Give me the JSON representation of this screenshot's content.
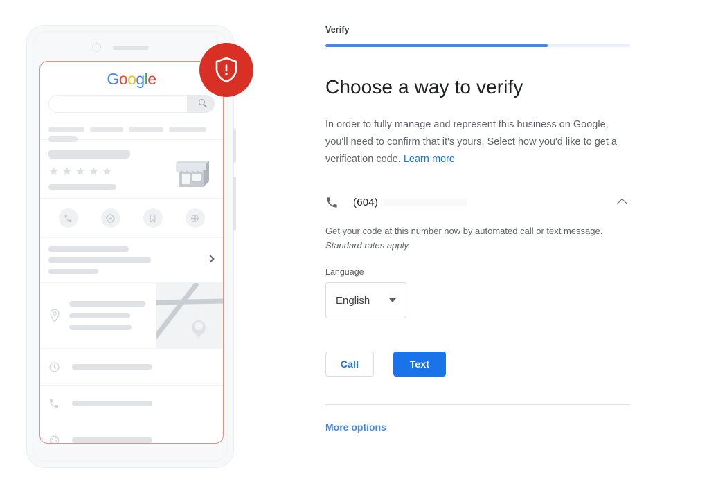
{
  "progress": {
    "step_label": "Verify",
    "percent": 73
  },
  "heading": "Choose a way to verify",
  "intro": {
    "text": "In order to fully manage and represent this business on Google, you'll need to confirm that it's yours. Select how you'd like to get a verification code. ",
    "link_label": "Learn more"
  },
  "verification_option": {
    "icon": "phone-icon",
    "phone_number": "(604)",
    "toggle_icon": "chevron-up-icon",
    "helper_text": "Get your code at this number now by automated call or text message. ",
    "helper_italic": "Standard rates apply.",
    "language_label": "Language",
    "language_value": "English",
    "language_caret": "caret-down-icon"
  },
  "actions": {
    "call_label": "Call",
    "text_label": "Text",
    "more_options_label": "More options"
  },
  "colors": {
    "accent_blue": "#4285F4",
    "link_blue": "#1a73e8",
    "alert_red": "#D93025",
    "google_blue": "#4285F4",
    "google_red": "#EA4335",
    "google_yellow": "#FBBC05",
    "google_green": "#34A853"
  },
  "illustration": {
    "badge_icon": "shield-alert-icon",
    "logo": {
      "G": "G",
      "o1": "o",
      "o2": "o",
      "g": "g",
      "l": "l",
      "e": "e"
    },
    "search_icon": "search-icon",
    "camera_icon": "camera-dot",
    "speaker_icon": "speaker-slot",
    "storefront_icon": "storefront-icon",
    "rating_stars": 5,
    "star_glyph": "★",
    "action_icons": [
      "call-icon",
      "directions-icon",
      "save-icon",
      "website-icon"
    ],
    "chevron_icon": "chevron-right-icon",
    "place_icon": "map-pin-icon",
    "map_icon": "map-thumbnail",
    "info_rows": [
      "clock-icon",
      "phone-icon",
      "globe-icon"
    ]
  }
}
